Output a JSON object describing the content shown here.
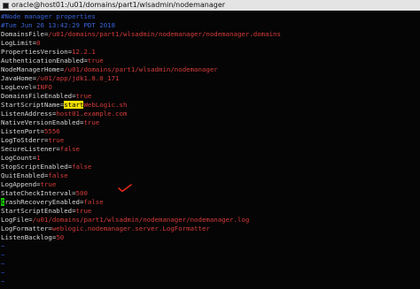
{
  "window": {
    "title": "oracle@host01:/u01/domains/part1/wlsadmin/nodemanager"
  },
  "editor": {
    "lines": [
      {
        "type": "comment",
        "text": "#Node manager properties"
      },
      {
        "type": "comment",
        "text": "#Tue Jun 26 13:42:29 PDT 2018"
      },
      {
        "type": "prop",
        "key": "DomainsFile",
        "value": "/u01/domains/part1/wlsadmin/nodemanager/nodemanager.domains"
      },
      {
        "type": "prop",
        "key": "LogLimit",
        "value": "0"
      },
      {
        "type": "prop",
        "key": "PropertiesVersion",
        "value": "12.2.1"
      },
      {
        "type": "prop",
        "key": "AuthenticationEnabled",
        "value": "true"
      },
      {
        "type": "prop",
        "key": "NodeManagerHome",
        "value": "/u01/domains/part1/wlsadmin/nodemanager"
      },
      {
        "type": "prop",
        "key": "JavaHome",
        "value": "/u01/app/jdk1.8.0_171"
      },
      {
        "type": "prop",
        "key": "LogLevel",
        "value": "INFO"
      },
      {
        "type": "prop",
        "key": "DomainsFileEnabled",
        "value": "true"
      },
      {
        "type": "prop",
        "key": "StartScriptName",
        "value": "startWebLogic.sh",
        "highlight": "start"
      },
      {
        "type": "prop",
        "key": "ListenAddress",
        "value": "host01.example.com"
      },
      {
        "type": "prop",
        "key": "NativeVersionEnabled",
        "value": "true"
      },
      {
        "type": "prop",
        "key": "ListenPort",
        "value": "5556"
      },
      {
        "type": "prop",
        "key": "LogToStderr",
        "value": "true"
      },
      {
        "type": "prop",
        "key": "SecureListener",
        "value": "false"
      },
      {
        "type": "prop",
        "key": "LogCount",
        "value": "1"
      },
      {
        "type": "prop",
        "key": "StopScriptEnabled",
        "value": "false"
      },
      {
        "type": "prop",
        "key": "QuitEnabled",
        "value": "false"
      },
      {
        "type": "prop",
        "key": "LogAppend",
        "value": "true"
      },
      {
        "type": "prop",
        "key": "StateCheckInterval",
        "value": "500"
      },
      {
        "type": "prop",
        "key": "CrashRecoveryEnabled",
        "value": "false",
        "cursor": "C"
      },
      {
        "type": "prop",
        "key": "StartScriptEnabled",
        "value": "true"
      },
      {
        "type": "prop",
        "key": "LogFile",
        "value": "/u01/domains/part1/wlsadmin/nodemanager/nodemanager.log"
      },
      {
        "type": "prop",
        "key": "LogFormatter",
        "value": "weblogic.nodemanager.server.LogFormatter"
      },
      {
        "type": "prop",
        "key": "ListenBacklog",
        "value": "50"
      },
      {
        "type": "tilde",
        "text": "~"
      },
      {
        "type": "tilde",
        "text": "~"
      },
      {
        "type": "tilde",
        "text": "~"
      },
      {
        "type": "tilde",
        "text": "~"
      },
      {
        "type": "tilde",
        "text": "~"
      }
    ]
  },
  "colors": {
    "key": "#d7d7d7",
    "value": "#d63b3b",
    "comment": "#3a63d8",
    "tilde": "#2f52d0",
    "search_highlight": "#f2e000",
    "cursor": "#17c800",
    "annotation": "#e0281a"
  },
  "annotation": {
    "icon": "red-checkmark-icon"
  }
}
